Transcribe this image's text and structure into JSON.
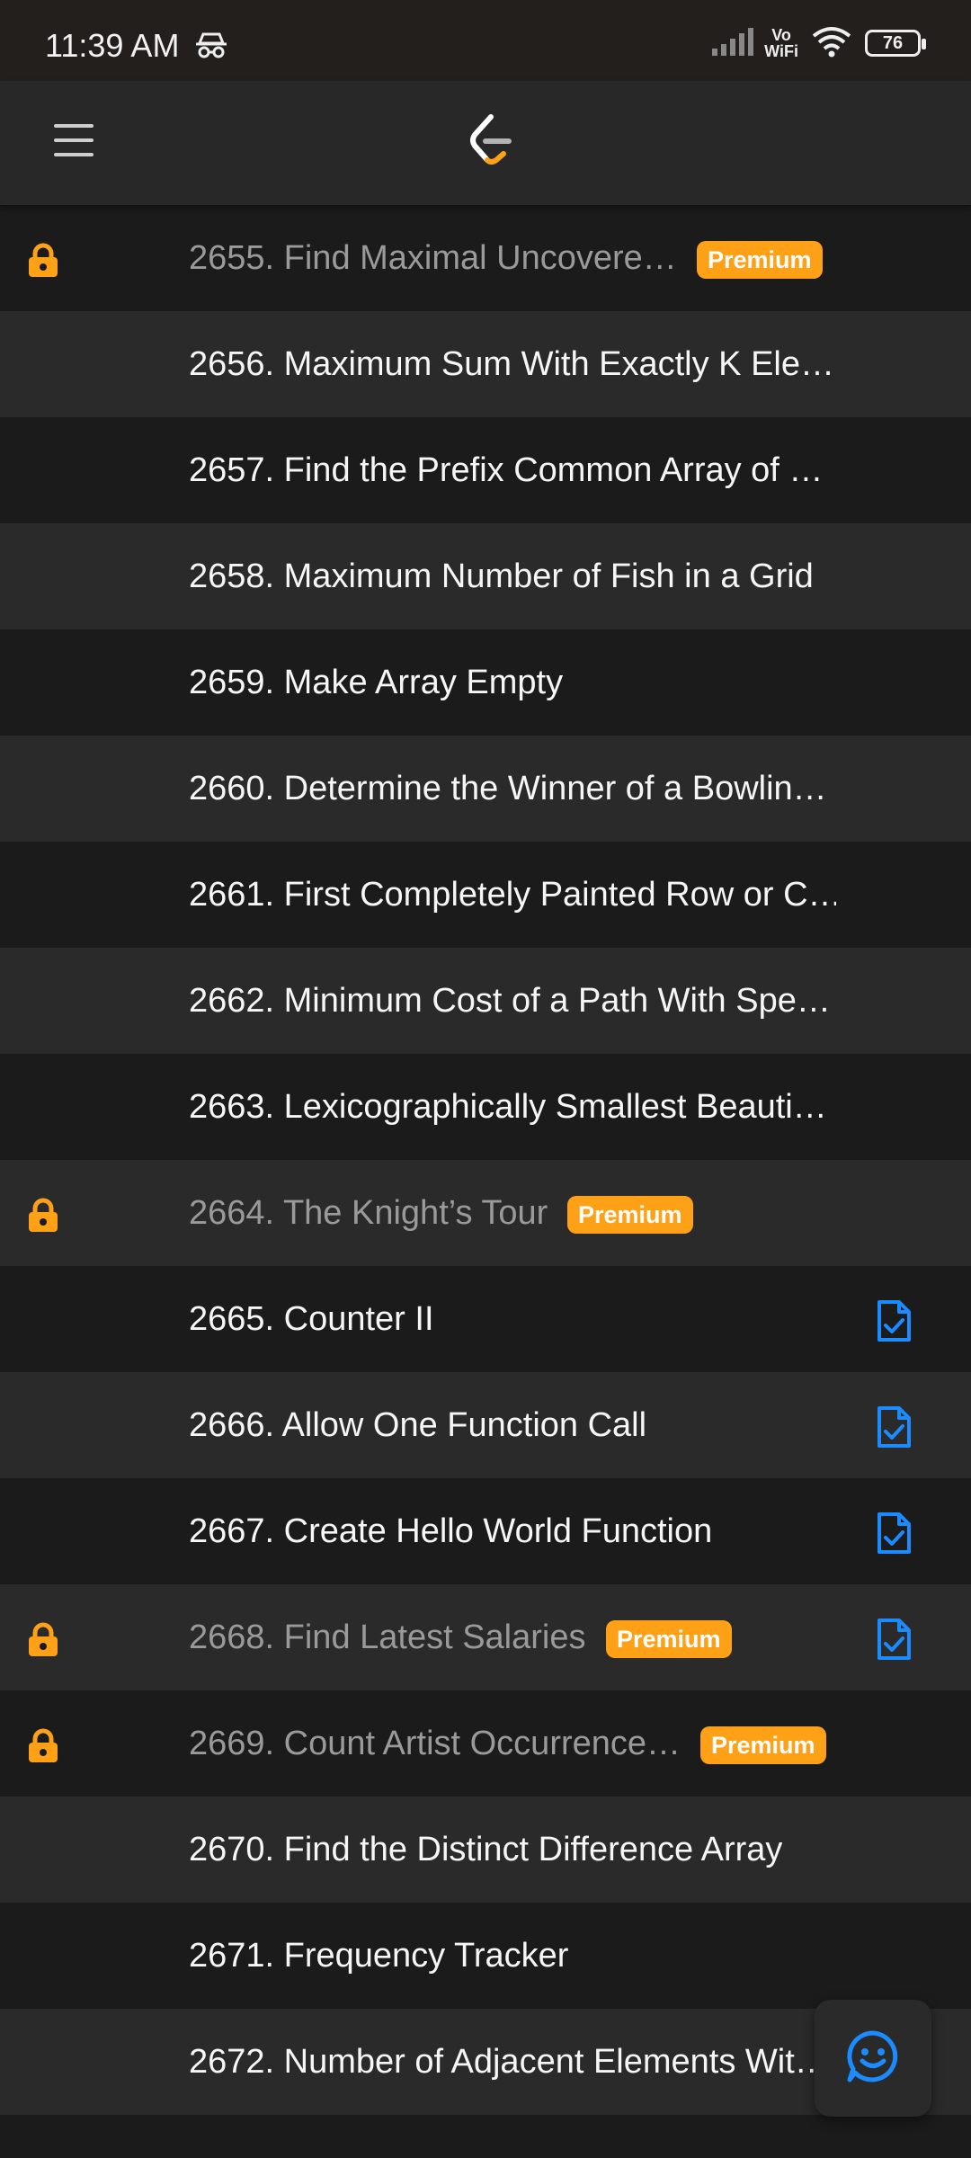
{
  "status_bar": {
    "time": "11:39 AM",
    "network_label": "Vo\nWiFi",
    "battery": "76",
    "icons": [
      "incognito-icon",
      "signal-icon",
      "wifi-icon",
      "battery-icon"
    ]
  },
  "app_bar": {
    "menu_icon": "menu-icon",
    "logo_icon": "leetcode-logo-icon"
  },
  "colors": {
    "premium_badge": "#ffa116",
    "lock": "#ffa116",
    "solution_icon": "#1a8cff",
    "row_dark": "#1b1b1b",
    "row_light": "#2a2a2a"
  },
  "problems": [
    {
      "title": "2655. Find Maximal Uncovere…",
      "locked": true,
      "badge": "Premium",
      "solution": false
    },
    {
      "title": "2656. Maximum Sum With Exactly K Ele…",
      "locked": false,
      "badge": "",
      "solution": false
    },
    {
      "title": "2657. Find the Prefix Common Array of …",
      "locked": false,
      "badge": "",
      "solution": false
    },
    {
      "title": "2658. Maximum Number of Fish in a Grid",
      "locked": false,
      "badge": "",
      "solution": false
    },
    {
      "title": "2659. Make Array Empty",
      "locked": false,
      "badge": "",
      "solution": false
    },
    {
      "title": "2660. Determine the Winner of a Bowlin…",
      "locked": false,
      "badge": "",
      "solution": false
    },
    {
      "title": "2661. First Completely Painted Row or C…",
      "locked": false,
      "badge": "",
      "solution": false
    },
    {
      "title": "2662. Minimum Cost of a Path With Spe…",
      "locked": false,
      "badge": "",
      "solution": false
    },
    {
      "title": "2663. Lexicographically Smallest Beauti…",
      "locked": false,
      "badge": "",
      "solution": false
    },
    {
      "title": "2664. The Knight’s Tour",
      "locked": true,
      "badge": "Premium",
      "solution": false
    },
    {
      "title": "2665. Counter II",
      "locked": false,
      "badge": "",
      "solution": true
    },
    {
      "title": "2666. Allow One Function Call",
      "locked": false,
      "badge": "",
      "solution": true
    },
    {
      "title": "2667. Create Hello World Function",
      "locked": false,
      "badge": "",
      "solution": true
    },
    {
      "title": "2668. Find Latest Salaries",
      "locked": true,
      "badge": "Premium",
      "solution": true
    },
    {
      "title": "2669. Count Artist Occurrence…",
      "locked": true,
      "badge": "Premium",
      "solution": false
    },
    {
      "title": "2670. Find the Distinct Difference Array",
      "locked": false,
      "badge": "",
      "solution": false
    },
    {
      "title": "2671. Frequency Tracker",
      "locked": false,
      "badge": "",
      "solution": false
    },
    {
      "title": "2672. Number of Adjacent Elements Wit…",
      "locked": false,
      "badge": "",
      "solution": false
    }
  ],
  "fab_icon": "feedback-smile-icon"
}
